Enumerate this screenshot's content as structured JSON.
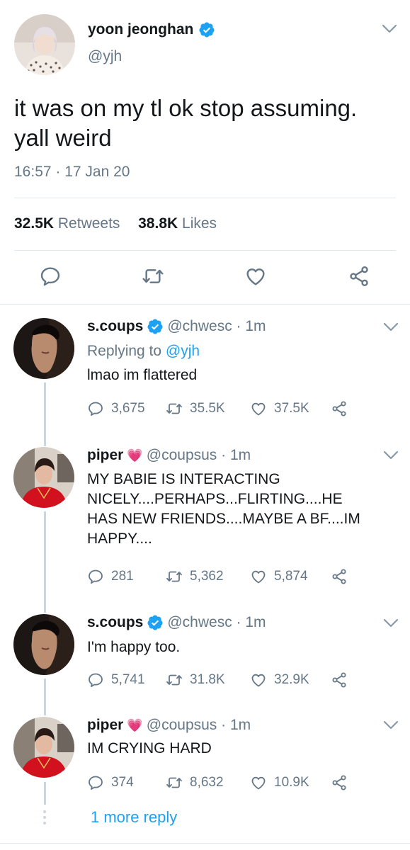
{
  "main_tweet": {
    "display_name": "yoon jeonghan",
    "handle": "@yjh",
    "text_line1": "it was on my tl ok stop assuming.",
    "text_line2": "yall weird",
    "timestamp": "16:57 · 17 Jan 20",
    "retweets_count": "32.5K",
    "retweets_label": "Retweets",
    "likes_count": "38.8K",
    "likes_label": "Likes",
    "verified": true
  },
  "replies": [
    {
      "display_name": "s.coups",
      "verified": true,
      "handle_time": "@chwesc · 1m",
      "replying_prefix": "Replying to",
      "replying_to": "@yjh",
      "text": [
        "lmao im flattered"
      ],
      "replies": "3,675",
      "retweets": "35.5K",
      "likes": "37.5K"
    },
    {
      "display_name": "piper",
      "heart_emoji": "💗",
      "handle_time": "@coupsus · 1m",
      "text": [
        "MY BABIE IS INTERACTING",
        "NICELY....PERHAPS...FLIRTING....HE",
        "HAS NEW FRIENDS....MAYBE A BF....IM",
        "HAPPY...."
      ],
      "replies": "281",
      "retweets": "5,362",
      "likes": "5,874"
    },
    {
      "display_name": "s.coups",
      "verified": true,
      "handle_time": "@chwesc · 1m",
      "text": [
        "I'm happy too."
      ],
      "replies": "5,741",
      "retweets": "31.8K",
      "likes": "32.9K"
    },
    {
      "display_name": "piper",
      "heart_emoji": "💗",
      "handle_time": "@coupsus · 1m",
      "text": [
        "IM CRYING HARD"
      ],
      "replies": "374",
      "retweets": "8,632",
      "likes": "10.9K"
    }
  ],
  "more_replies_label": "1 more reply",
  "colors": {
    "accent": "#1da1f2",
    "secondary_text": "#657786",
    "divider": "#e1e8ed",
    "thread_line": "#ccd6dd"
  },
  "icons": [
    "verified-badge-icon",
    "chevron-down-icon",
    "reply-icon",
    "retweet-icon",
    "like-icon",
    "share-icon"
  ]
}
